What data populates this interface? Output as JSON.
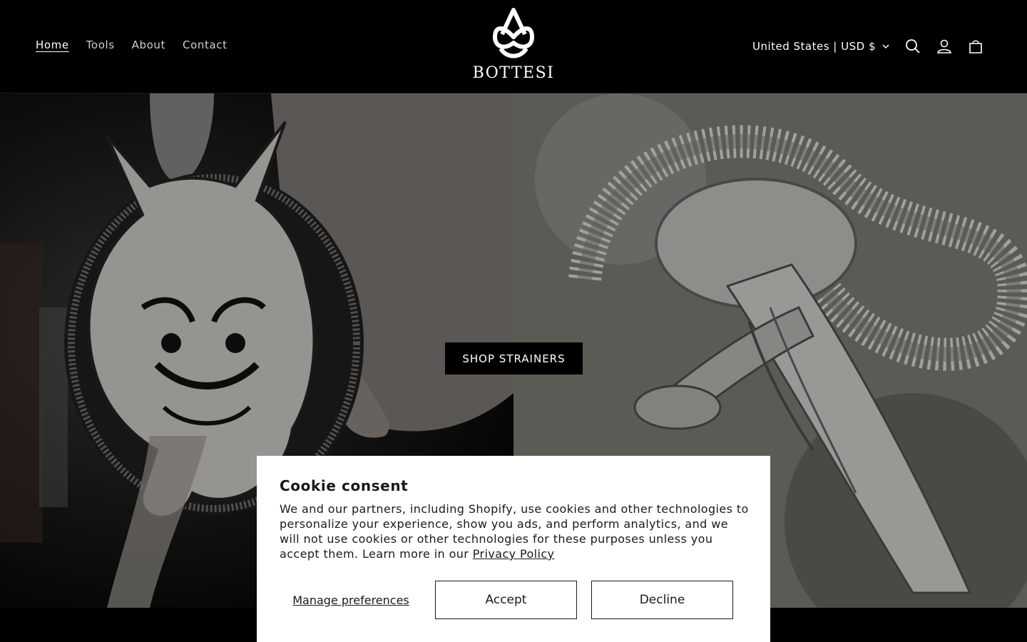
{
  "header": {
    "nav": [
      {
        "label": "Home",
        "active": true
      },
      {
        "label": "Tools",
        "active": false
      },
      {
        "label": "About",
        "active": false
      },
      {
        "label": "Contact",
        "active": false
      }
    ],
    "logo_text": "BOTTESI",
    "country_selector": "United States | USD $",
    "icons": [
      "search-icon",
      "account-icon",
      "cart-icon"
    ]
  },
  "hero": {
    "cta_label": "SHOP STRAINERS"
  },
  "cookie": {
    "title": "Cookie consent",
    "body": "We and our partners, including Shopify, use cookies and other technologies to personalize your experience, show you ads, and perform analytics, and we will not use cookies or other technologies for these purposes unless you accept them. Learn more in our ",
    "privacy_link": "Privacy Policy",
    "manage_label": "Manage preferences",
    "accept_label": "Accept",
    "decline_label": "Decline"
  },
  "colors": {
    "background": "#000000",
    "text": "#ffffff",
    "dialog_bg": "#ffffff",
    "dialog_text": "#1a1a1a"
  }
}
